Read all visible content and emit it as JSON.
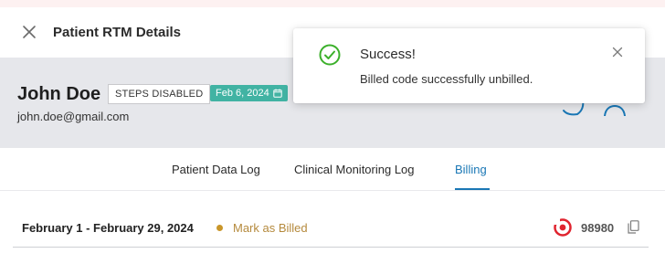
{
  "header": {
    "title": "Patient RTM Details",
    "close_icon": "close-icon"
  },
  "patient": {
    "name": "John Doe",
    "status_badge": "STEPS DISABLED",
    "date_badge": "Feb 6, 2024",
    "email": "john.doe@gmail.com",
    "badge_color": "#41b3a3"
  },
  "tabs": [
    {
      "label": "Patient Data Log",
      "active": false
    },
    {
      "label": "Clinical Monitoring Log",
      "active": false
    },
    {
      "label": "Billing",
      "active": true
    }
  ],
  "billing": {
    "period": "February 1 - February 29, 2024",
    "action": "Mark as Billed",
    "code": "98980",
    "status_color": "#c9962a"
  },
  "toast": {
    "title": "Success!",
    "message": "Billed code successfully unbilled.",
    "success_color": "#3cb02b"
  }
}
